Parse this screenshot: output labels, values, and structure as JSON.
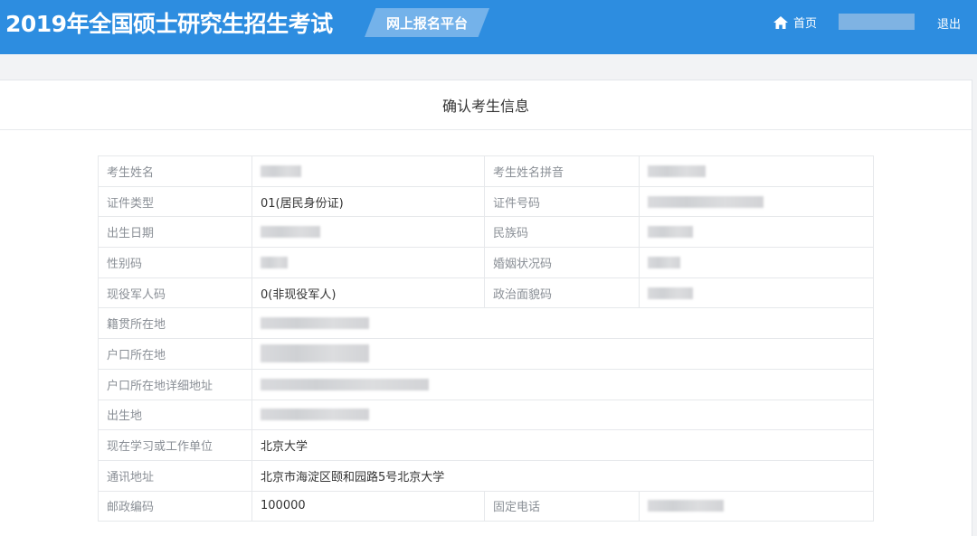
{
  "header": {
    "app_title": "2019年全国硕士研究生招生考试",
    "platform_label": "网上报名平台",
    "home_label": "首页",
    "logout_label": "退出"
  },
  "panel": {
    "title": "确认考生信息"
  },
  "form": {
    "name_label": "考生姓名",
    "name_pinyin_label": "考生姓名拼音",
    "id_type_label": "证件类型",
    "id_type_value": "01(居民身份证)",
    "id_number_label": "证件号码",
    "birth_date_label": "出生日期",
    "ethnicity_label": "民族码",
    "gender_label": "性别码",
    "marital_label": "婚姻状况码",
    "military_label": "现役军人码",
    "military_value": "0(非现役军人)",
    "political_label": "政治面貌码",
    "native_place_label": "籍贯所在地",
    "hukou_label": "户口所在地",
    "hukou_address_label": "户口所在地详细地址",
    "birthplace_label": "出生地",
    "workplace_label": "现在学习或工作单位",
    "workplace_value": "北京大学",
    "mail_address_label": "通讯地址",
    "mail_address_value": "北京市海淀区颐和园路5号北京大学",
    "postcode_label": "邮政编码",
    "postcode_value": "100000",
    "phone_label": "固定电话"
  },
  "colors": {
    "header_bg": "#2d8de0",
    "badge_bg": "#74b2ea",
    "label_text": "#8a8f96"
  }
}
